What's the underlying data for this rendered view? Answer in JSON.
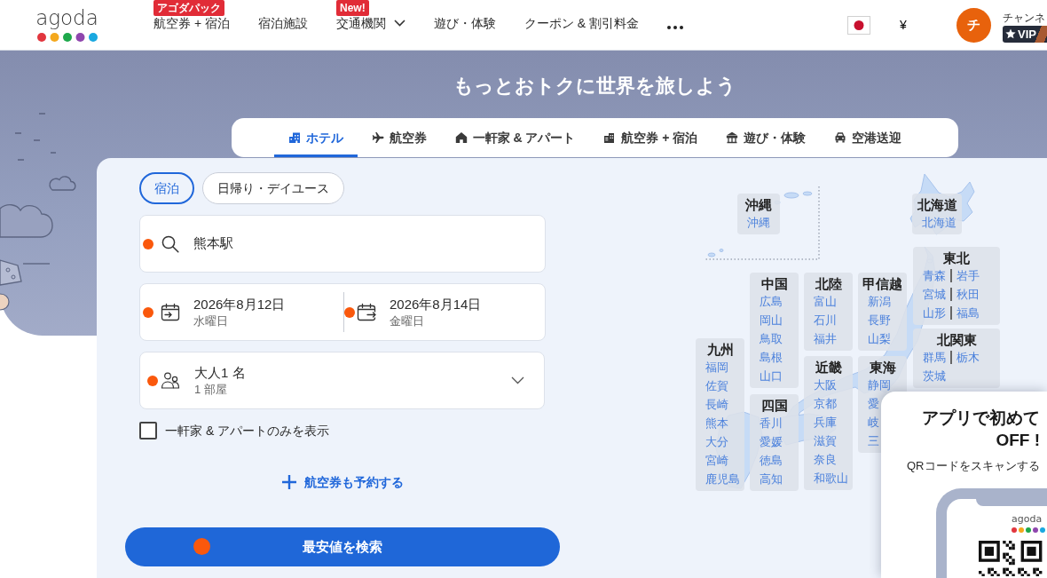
{
  "header": {
    "logo": "agoda",
    "nav": [
      {
        "label": "航空券 + 宿泊",
        "badge": "アゴダパック",
        "dropdown": false
      },
      {
        "label": "宿泊施設",
        "dropdown": false
      },
      {
        "label": "交通機関",
        "badge": "New!",
        "dropdown": true
      },
      {
        "label": "遊び・体験",
        "dropdown": false
      },
      {
        "label": "クーポン & 割引料金",
        "dropdown": false
      }
    ],
    "currency": "¥",
    "user": {
      "initial": "チ",
      "name": "チャンネ",
      "tier": "VIP"
    }
  },
  "hero": {
    "title": "もっとおトクに世界を旅しよう"
  },
  "tabs": [
    {
      "label": "ホテル",
      "kind": "hotel",
      "selected": true
    },
    {
      "label": "航空券",
      "kind": "flight",
      "selected": false
    },
    {
      "label": "一軒家 & アパート",
      "kind": "home",
      "selected": false
    },
    {
      "label": "航空券 + 宿泊",
      "kind": "package",
      "selected": false
    },
    {
      "label": "遊び・体験",
      "kind": "activity",
      "selected": false
    },
    {
      "label": "空港送迎",
      "kind": "transfer",
      "selected": false
    }
  ],
  "stay_types": [
    {
      "label": "宿泊",
      "selected": true
    },
    {
      "label": "日帰り・デイユース",
      "selected": false
    }
  ],
  "destination": {
    "value": "熊本駅"
  },
  "dates": [
    {
      "kind": "check-in",
      "date": "2026年8月12日",
      "weekday": "水曜日"
    },
    {
      "kind": "check-out",
      "date": "2026年8月14日",
      "weekday": "金曜日"
    }
  ],
  "occupancy": {
    "guests": "大人1 名",
    "rooms": "1 部屋"
  },
  "homes_only": {
    "label": "一軒家 & アパートのみを表示",
    "checked": false
  },
  "add_flight": {
    "label": "航空券も予約する"
  },
  "search_button": {
    "label": "最安値を検索"
  },
  "map": {
    "regions": [
      {
        "name": "沖縄",
        "rows": [
          [
            "沖縄"
          ]
        ]
      },
      {
        "name": "北海道",
        "rows": [
          [
            "北海道"
          ]
        ]
      },
      {
        "name": "東北",
        "rows": [
          [
            "青森",
            "岩手"
          ],
          [
            "宮城",
            "秋田"
          ],
          [
            "山形",
            "福島"
          ]
        ]
      },
      {
        "name": "中国",
        "rows": [
          [
            "広島"
          ],
          [
            "岡山"
          ],
          [
            "鳥取"
          ],
          [
            "島根"
          ],
          [
            "山口"
          ]
        ]
      },
      {
        "name": "北陸",
        "rows": [
          [
            "富山"
          ],
          [
            "石川"
          ],
          [
            "福井"
          ]
        ]
      },
      {
        "name": "甲信越",
        "rows": [
          [
            "新潟"
          ],
          [
            "長野"
          ],
          [
            "山梨"
          ]
        ]
      },
      {
        "name": "北関東",
        "rows": [
          [
            "群馬",
            "栃木"
          ],
          [
            "茨城"
          ]
        ]
      },
      {
        "name": "九州",
        "rows": [
          [
            "福岡"
          ],
          [
            "佐賀"
          ],
          [
            "長崎"
          ],
          [
            "熊本"
          ],
          [
            "大分"
          ],
          [
            "宮崎"
          ],
          [
            "鹿児島"
          ]
        ]
      },
      {
        "name": "近畿",
        "rows": [
          [
            "大阪"
          ],
          [
            "京都"
          ],
          [
            "兵庫"
          ],
          [
            "滋賀"
          ],
          [
            "奈良"
          ],
          [
            "和歌山"
          ]
        ]
      },
      {
        "name": "東海",
        "rows": [
          [
            "静岡"
          ],
          [
            "愛"
          ],
          [
            "岐"
          ],
          [
            "三"
          ]
        ]
      },
      {
        "name": "四国",
        "rows": [
          [
            "香川"
          ],
          [
            "愛媛"
          ],
          [
            "徳島"
          ],
          [
            "高知"
          ]
        ]
      }
    ]
  },
  "app_promo": {
    "title_lines": [
      "アプリで初めて",
      "OFF !"
    ],
    "subtitle": "QRコードをスキャンする",
    "logo": "agoda"
  }
}
